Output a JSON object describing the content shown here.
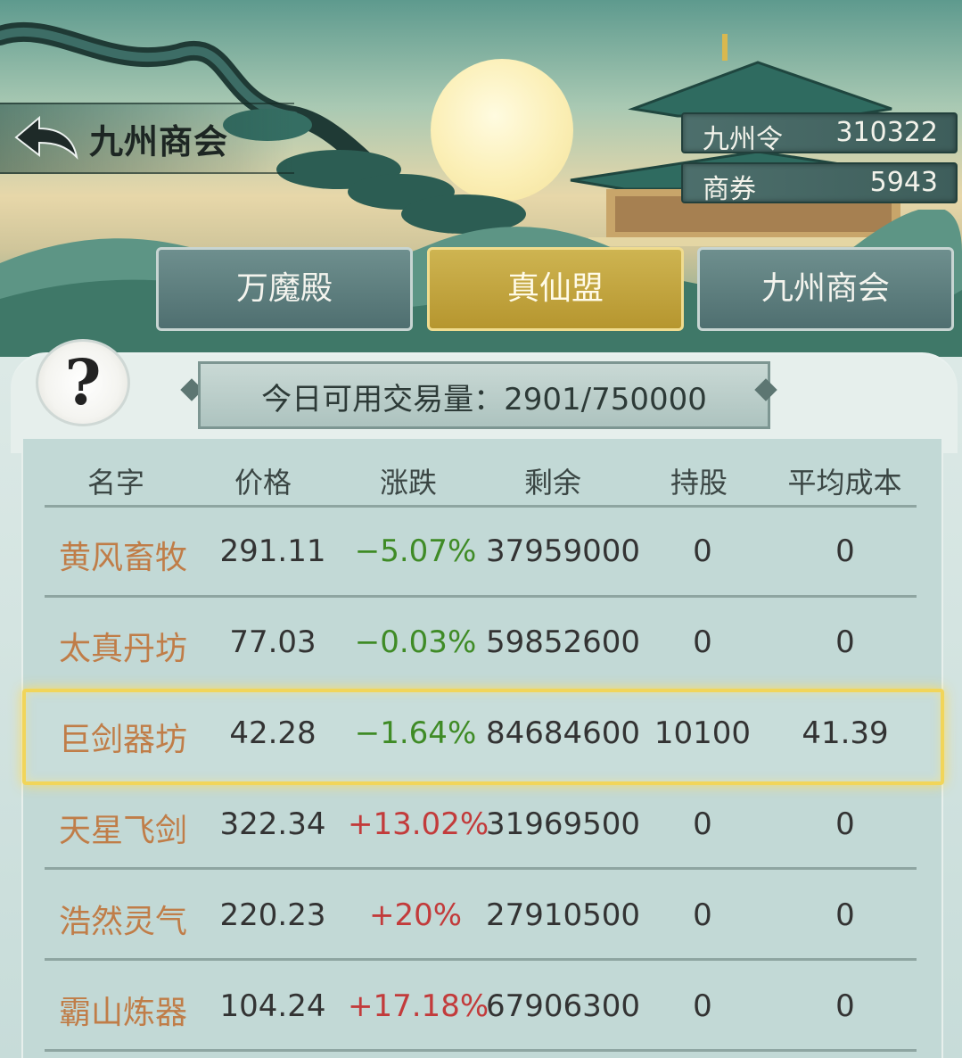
{
  "header": {
    "title": "九州商会"
  },
  "resources": [
    {
      "label": "九州令",
      "value": "310322"
    },
    {
      "label": "商券",
      "value": "5943"
    }
  ],
  "tabs": [
    {
      "label": "万魔殿",
      "active": false
    },
    {
      "label": "真仙盟",
      "active": true
    },
    {
      "label": "九州商会",
      "active": false
    }
  ],
  "help": {
    "glyph": "?"
  },
  "volume": {
    "text": "今日可用交易量：2901/750000"
  },
  "table": {
    "headers": [
      "名字",
      "价格",
      "涨跌",
      "剩余",
      "持股",
      "平均成本"
    ],
    "rows": [
      {
        "name": "黄风畜牧",
        "price": "291.11",
        "change": "−5.07%",
        "trend": "down",
        "remaining": "37959000",
        "held": "0",
        "avg_cost": "0"
      },
      {
        "name": "太真丹坊",
        "price": "77.03",
        "change": "−0.03%",
        "trend": "down",
        "remaining": "59852600",
        "held": "0",
        "avg_cost": "0"
      },
      {
        "name": "巨剑器坊",
        "price": "42.28",
        "change": "−1.64%",
        "trend": "down",
        "remaining": "84684600",
        "held": "10100",
        "avg_cost": "41.39",
        "selected": true
      },
      {
        "name": "天星飞剑",
        "price": "322.34",
        "change": "+13.02%",
        "trend": "up",
        "remaining": "31969500",
        "held": "0",
        "avg_cost": "0"
      },
      {
        "name": "浩然灵气",
        "price": "220.23",
        "change": "+20%",
        "trend": "up",
        "remaining": "27910500",
        "held": "0",
        "avg_cost": "0"
      },
      {
        "name": "霸山炼器",
        "price": "104.24",
        "change": "+17.18%",
        "trend": "up",
        "remaining": "67906300",
        "held": "0",
        "avg_cost": "0"
      }
    ]
  },
  "colors": {
    "name_text": "#c07d48",
    "down": "#3f8b26",
    "up": "#c23b3b",
    "active_tab": "#ceb451",
    "selected_border": "#f1d55a"
  }
}
